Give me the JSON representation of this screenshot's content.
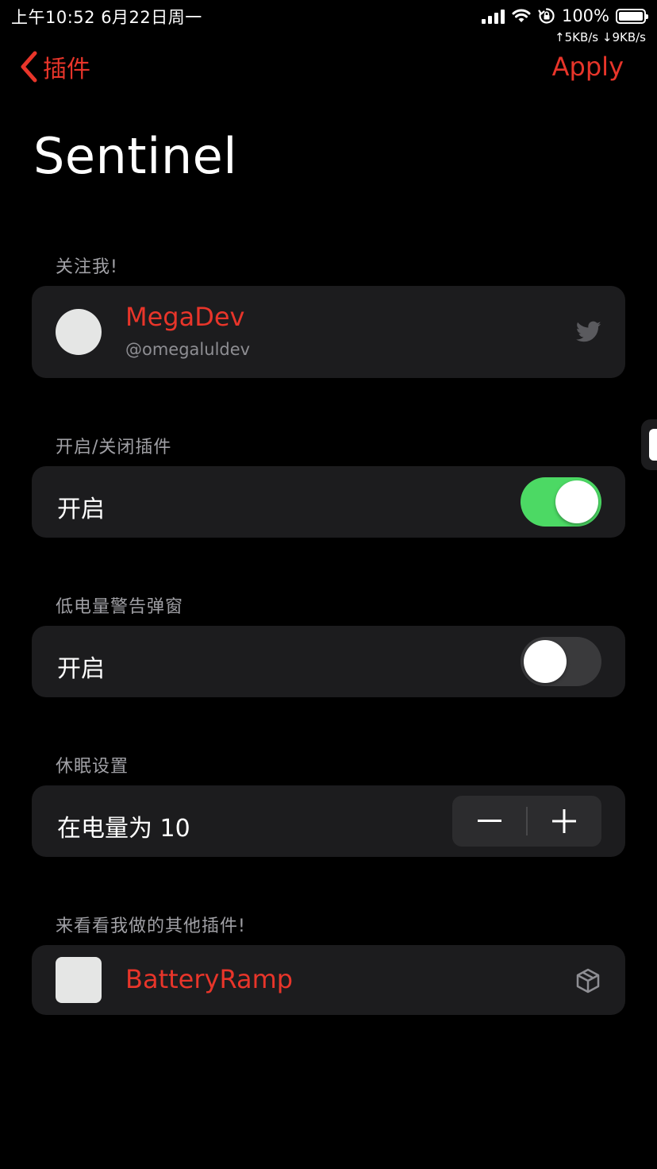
{
  "status_bar": {
    "time": "上午10:52  6月22日周一",
    "battery": "100%",
    "network_speed": "↑5KB/s ↓9KB/s",
    "icons": [
      "signal-icon",
      "wifi-icon",
      "rotation-lock-icon",
      "battery-icon"
    ]
  },
  "nav": {
    "back_label": "插件",
    "apply_label": "Apply"
  },
  "page": {
    "title": "Sentinel"
  },
  "follow_section": {
    "header": "关注我!",
    "name": "MegaDev",
    "handle": "@omegaluldev",
    "icon": "twitter-icon"
  },
  "toggle_tweak_section": {
    "header": "开启/关闭插件",
    "label": "开启",
    "enabled": true
  },
  "low_power_section": {
    "header": "低电量警告弹窗",
    "label": "开启",
    "enabled": false
  },
  "hibernate_section": {
    "header": "休眠设置",
    "label": "在电量为 10",
    "value": 10
  },
  "other_tweaks_section": {
    "header": "来看看我做的其他插件!",
    "items": [
      {
        "name": "BatteryRamp",
        "icon": "package-icon"
      }
    ]
  },
  "colors": {
    "accent": "#e8352a",
    "toggle_on": "#4cd964",
    "card_bg": "#1c1c1e",
    "background": "#000000"
  }
}
